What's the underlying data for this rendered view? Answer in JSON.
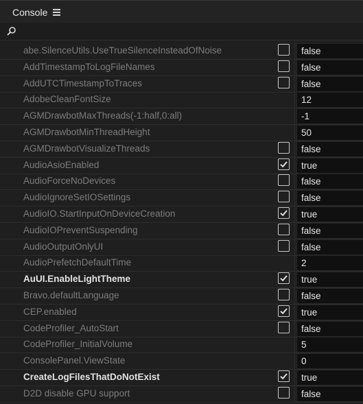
{
  "header": {
    "title": "Console",
    "menu_icon": "hamburger-menu-icon"
  },
  "search": {
    "icon": "search-icon",
    "value": ""
  },
  "rows": [
    {
      "name": "abe.SilenceUtils.UseTrueSilenceInsteadOfNoise",
      "checkbox": true,
      "checked": false,
      "value": "false",
      "bold": false
    },
    {
      "name": "AddTimestampToLogFileNames",
      "checkbox": true,
      "checked": false,
      "value": "false",
      "bold": false
    },
    {
      "name": "AddUTCTimestampToTraces",
      "checkbox": true,
      "checked": false,
      "value": "false",
      "bold": false
    },
    {
      "name": "AdobeCleanFontSize",
      "checkbox": false,
      "checked": false,
      "value": "12",
      "bold": false
    },
    {
      "name": "AGMDrawbotMaxThreads(-1:half,0:all)",
      "checkbox": false,
      "checked": false,
      "value": "-1",
      "bold": false
    },
    {
      "name": "AGMDrawbotMinThreadHeight",
      "checkbox": false,
      "checked": false,
      "value": "50",
      "bold": false
    },
    {
      "name": "AGMDrawbotVisualizeThreads",
      "checkbox": true,
      "checked": false,
      "value": "false",
      "bold": false
    },
    {
      "name": "AudioAsioEnabled",
      "checkbox": true,
      "checked": true,
      "value": "true",
      "bold": false
    },
    {
      "name": "AudioForceNoDevices",
      "checkbox": true,
      "checked": false,
      "value": "false",
      "bold": false
    },
    {
      "name": "AudioIgnoreSetIOSettings",
      "checkbox": true,
      "checked": false,
      "value": "false",
      "bold": false
    },
    {
      "name": "AudioIO.StartInputOnDeviceCreation",
      "checkbox": true,
      "checked": true,
      "value": "true",
      "bold": false
    },
    {
      "name": "AudioIOPreventSuspending",
      "checkbox": true,
      "checked": false,
      "value": "false",
      "bold": false
    },
    {
      "name": "AudioOutputOnlyUI",
      "checkbox": true,
      "checked": false,
      "value": "false",
      "bold": false
    },
    {
      "name": "AudioPrefetchDefaultTime",
      "checkbox": false,
      "checked": false,
      "value": "2",
      "bold": false
    },
    {
      "name": "AuUI.EnableLightTheme",
      "checkbox": true,
      "checked": true,
      "value": "true",
      "bold": true
    },
    {
      "name": "Bravo.defaultLanguage",
      "checkbox": true,
      "checked": false,
      "value": "false",
      "bold": false
    },
    {
      "name": "CEP.enabled",
      "checkbox": true,
      "checked": true,
      "value": "true",
      "bold": false
    },
    {
      "name": "CodeProfiler_AutoStart",
      "checkbox": true,
      "checked": false,
      "value": "false",
      "bold": false
    },
    {
      "name": "CodeProfiler_InitialVolume",
      "checkbox": false,
      "checked": false,
      "value": "5",
      "bold": false
    },
    {
      "name": "ConsolePanel.ViewState",
      "checkbox": false,
      "checked": false,
      "value": "0",
      "bold": false
    },
    {
      "name": "CreateLogFilesThatDoNotExist",
      "checkbox": true,
      "checked": true,
      "value": "true",
      "bold": true
    },
    {
      "name": "D2D disable GPU support",
      "checkbox": true,
      "checked": false,
      "value": "false",
      "bold": false
    }
  ]
}
